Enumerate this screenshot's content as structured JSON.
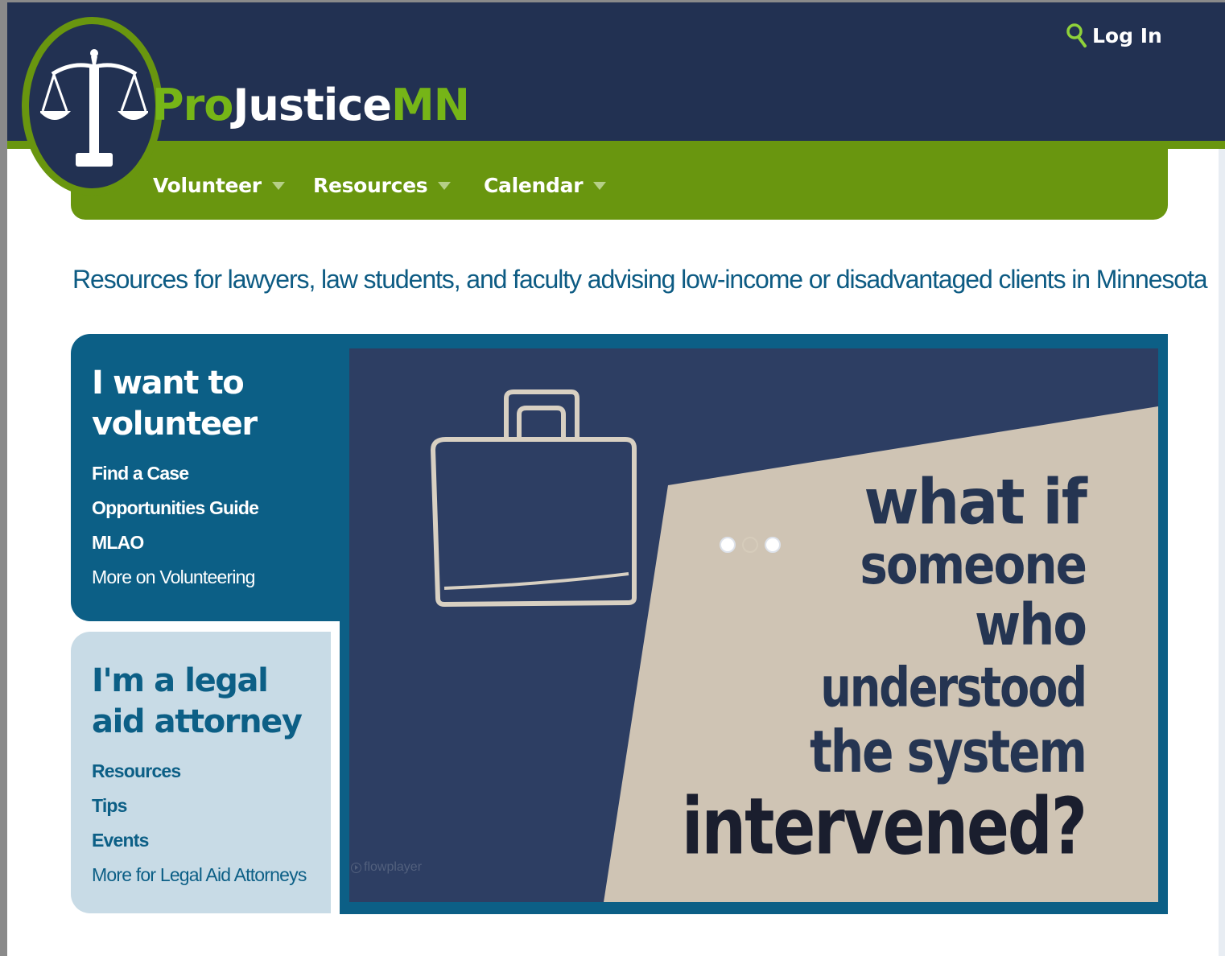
{
  "site": {
    "brand_pro": "Pro",
    "brand_justice": "Justice",
    "brand_mn": "MN",
    "login_label": "Log In",
    "colors": {
      "navy": "#223152",
      "green": "#69960f",
      "bright_green": "#76b517",
      "blue": "#0c5f86",
      "light_blue": "#c8dbe6",
      "tan": "#cfc4b4"
    }
  },
  "nav": {
    "items": [
      {
        "label": "Volunteer"
      },
      {
        "label": "Resources"
      },
      {
        "label": "Calendar"
      }
    ]
  },
  "main": {
    "tagline": "Resources for lawyers, law students, and faculty advising low-income or disadvantaged clients in Minnesota"
  },
  "volunteer_card": {
    "title": "I want to volunteer",
    "links": [
      {
        "label": "Find a Case"
      },
      {
        "label": "Opportunities Guide"
      },
      {
        "label": "MLAO"
      },
      {
        "label": "More on Volunteering"
      }
    ]
  },
  "legal_aid_card": {
    "title": "I'm a legal aid attorney",
    "links": [
      {
        "label": "Resources"
      },
      {
        "label": "Tips"
      },
      {
        "label": "Events"
      },
      {
        "label": "More for Legal Aid Attorneys"
      }
    ]
  },
  "video": {
    "lines": [
      "what if",
      "someone",
      "who",
      "understood",
      "the system",
      "intervened?"
    ],
    "player_label": "flowplayer",
    "icons": {
      "login": "search-icon",
      "logo": "scales-of-justice-icon",
      "video": "briefcase-icon"
    }
  }
}
